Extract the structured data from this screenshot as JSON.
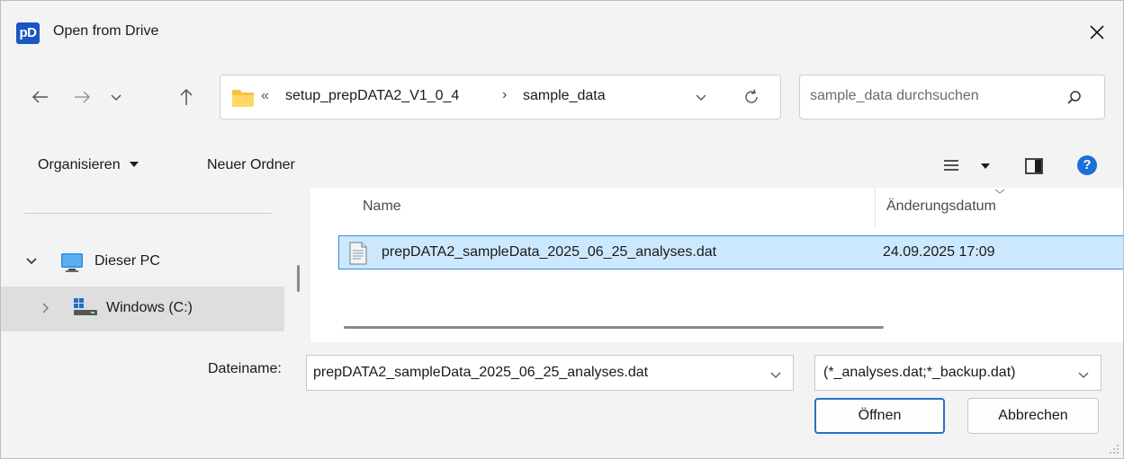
{
  "window": {
    "app_icon_text": "pD",
    "title": "Open from Drive",
    "close_symbol": "✕"
  },
  "address_bar": {
    "overflow_symbol": "«",
    "path": [
      "setup_prepDATA2_V1_0_4",
      "sample_data"
    ],
    "separator": "›"
  },
  "search": {
    "placeholder": "sample_data durchsuchen"
  },
  "toolbar": {
    "organize_label": "Organisieren",
    "new_folder_label": "Neuer Ordner",
    "help_label": "?"
  },
  "nav_pane": {
    "items": [
      {
        "label": "Dieser PC",
        "expanded": true,
        "icon": "monitor-icon"
      },
      {
        "label": "Windows  (C:)",
        "expanded": false,
        "icon": "drive-icon",
        "selected": true
      }
    ]
  },
  "file_list": {
    "columns": [
      "Name",
      "Änderungsdatum"
    ],
    "rows": [
      {
        "name": "prepDATA2_sampleData_2025_06_25_analyses.dat",
        "modified": "24.09.2025 17:09",
        "selected": true
      }
    ]
  },
  "footer": {
    "filename_label": "Dateiname:",
    "filename_value": "prepDATA2_sampleData_2025_06_25_analyses.dat",
    "filter_value": "(*_analyses.dat;*_backup.dat)",
    "open_label": "Öffnen",
    "cancel_label": "Abbrechen"
  },
  "colors": {
    "chrome_bg": "#f3f3f3",
    "selection_bg": "#cce8ff",
    "selection_border": "#3e88d6",
    "accent": "#2a6fc9",
    "folder": "#f6c342"
  }
}
